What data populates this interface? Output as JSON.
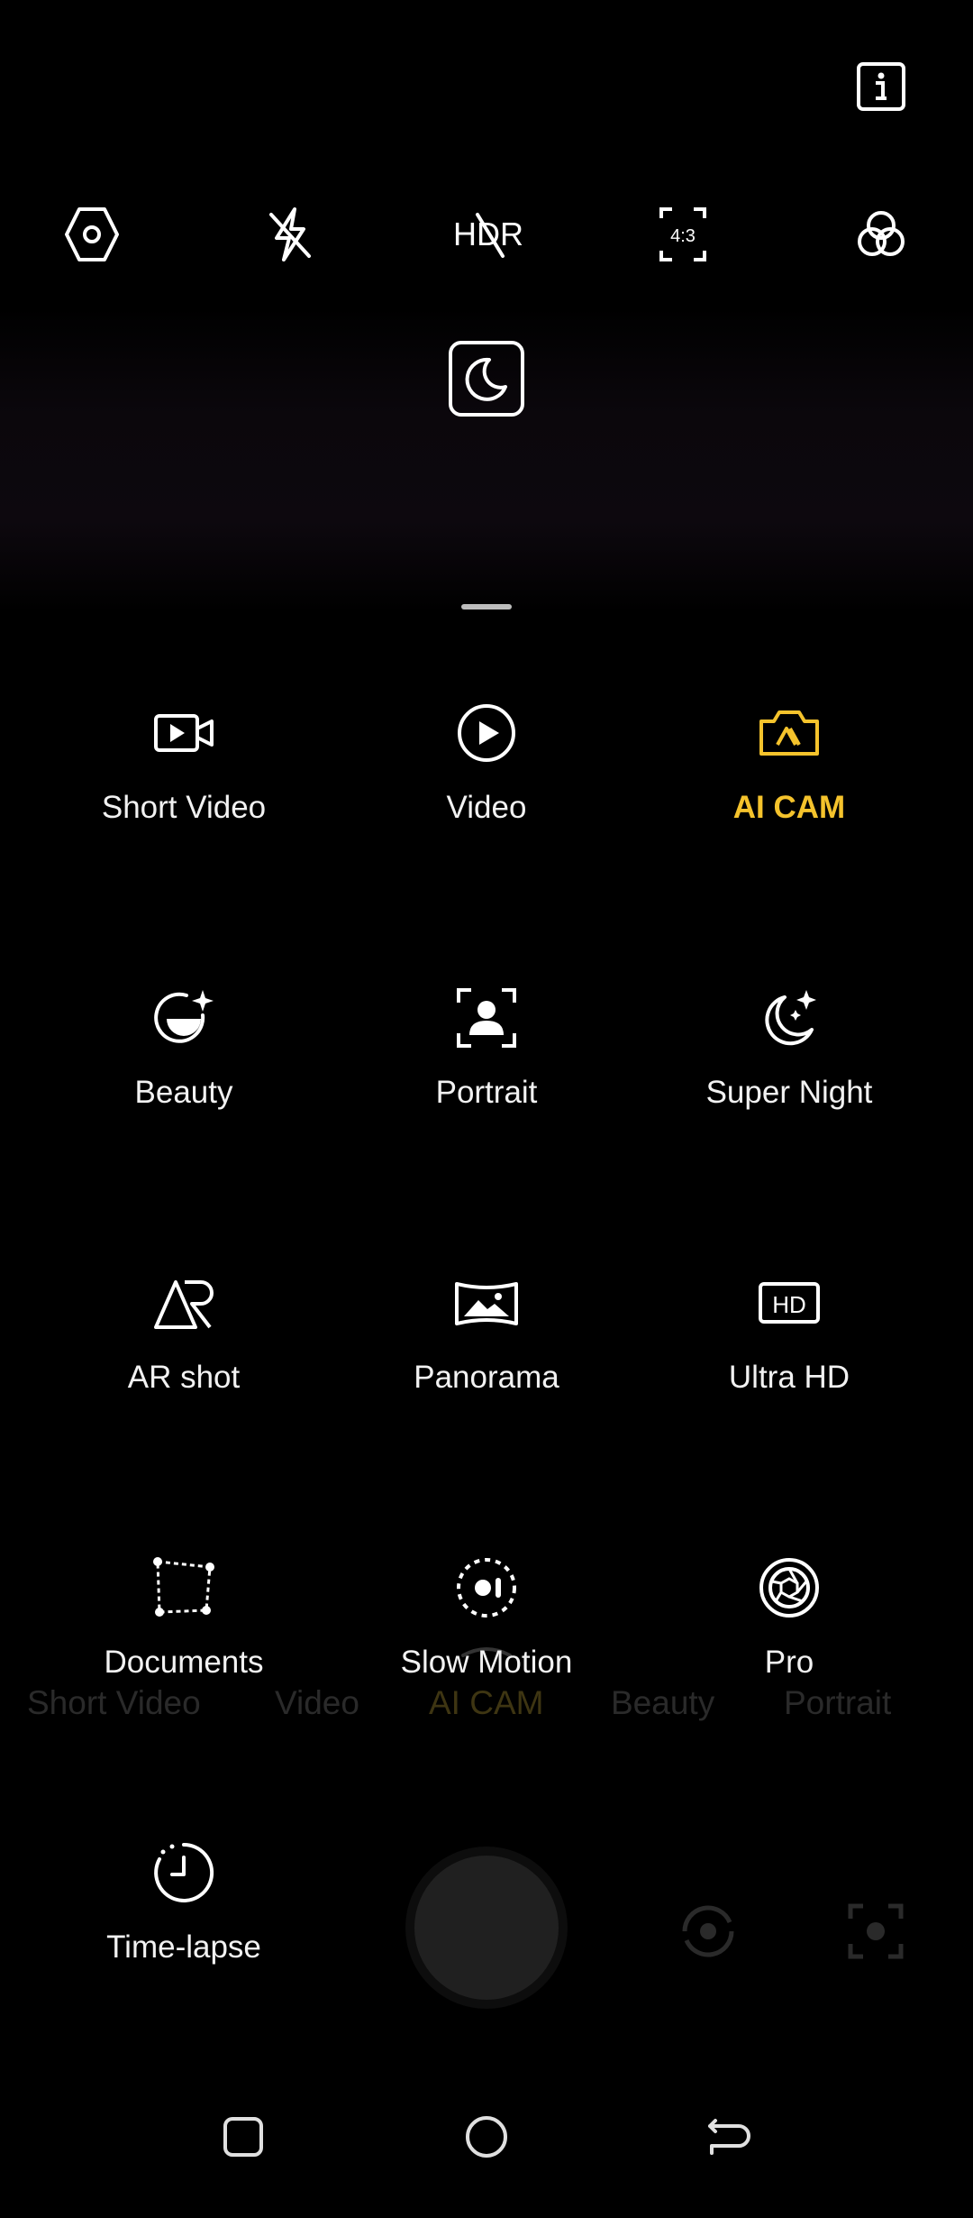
{
  "top_bar": {
    "icons": [
      "settings-icon",
      "flash-off-icon",
      "hdr-off-icon",
      "aspect-ratio-icon",
      "filters-icon"
    ],
    "aspect_ratio": "4:3",
    "hdr_text": "HDR"
  },
  "modes": [
    {
      "label": "Short Video",
      "icon": "short-video-icon",
      "active": false
    },
    {
      "label": "Video",
      "icon": "video-icon",
      "active": false
    },
    {
      "label": "AI CAM",
      "icon": "ai-cam-icon",
      "active": true
    },
    {
      "label": "Beauty",
      "icon": "beauty-icon",
      "active": false
    },
    {
      "label": "Portrait",
      "icon": "portrait-icon",
      "active": false
    },
    {
      "label": "Super Night",
      "icon": "super-night-icon",
      "active": false
    },
    {
      "label": "AR shot",
      "icon": "ar-shot-icon",
      "active": false
    },
    {
      "label": "Panorama",
      "icon": "panorama-icon",
      "active": false
    },
    {
      "label": "Ultra HD",
      "icon": "ultra-hd-icon",
      "active": false
    },
    {
      "label": "Documents",
      "icon": "documents-icon",
      "active": false
    },
    {
      "label": "Slow Motion",
      "icon": "slow-motion-icon",
      "active": false
    },
    {
      "label": "Pro",
      "icon": "pro-icon",
      "active": false
    },
    {
      "label": "Time-lapse",
      "icon": "time-lapse-icon",
      "active": false
    }
  ],
  "ultra_hd_badge": "HD",
  "background_mode_strip": [
    "Short Video",
    "Video",
    "AI CAM",
    "Beauty",
    "Portrait"
  ],
  "colors": {
    "accent": "#f5c32c",
    "background": "#000000",
    "text": "#f2f2f2"
  }
}
